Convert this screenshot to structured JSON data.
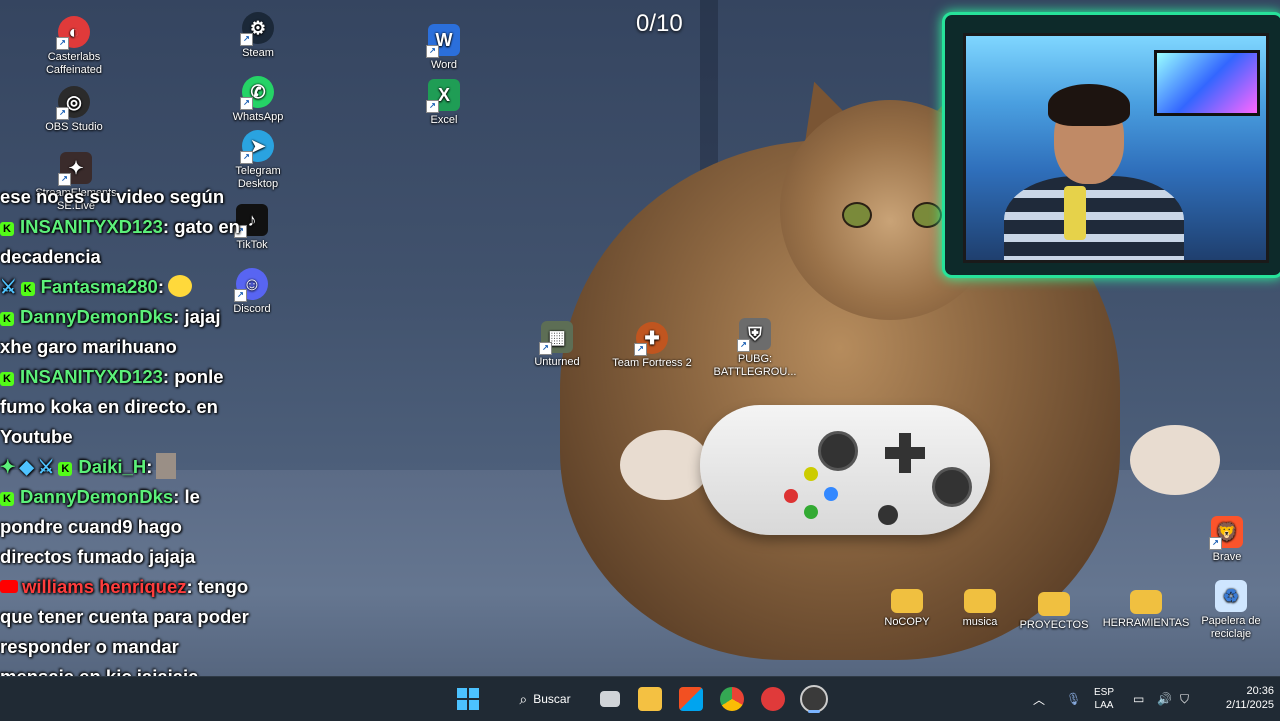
{
  "desktop": {
    "counter": "0/10",
    "icons": [
      {
        "label": "Casterlabs Caffeinated",
        "icon": "casterlabs-icon",
        "color": "#e03a3a"
      },
      {
        "label": "OBS Studio",
        "icon": "obs-icon",
        "color": "#2b2b2b"
      },
      {
        "label": "StreamElements SE.Live",
        "icon": "streamelements-icon",
        "color": "#3a2b2b"
      },
      {
        "label": "Steam",
        "icon": "steam-icon",
        "color": "#1b2838"
      },
      {
        "label": "WhatsApp",
        "icon": "whatsapp-icon",
        "color": "#25d366"
      },
      {
        "label": "Telegram Desktop",
        "icon": "telegram-icon",
        "color": "#2aa3e0"
      },
      {
        "label": "TikTok",
        "icon": "tiktok-icon",
        "color": "#111111"
      },
      {
        "label": "Discord",
        "icon": "discord-icon",
        "color": "#5865f2"
      },
      {
        "label": "Word",
        "icon": "word-icon",
        "color": "#2b6fdb"
      },
      {
        "label": "Excel",
        "icon": "excel-icon",
        "color": "#1f9d55"
      },
      {
        "label": "Unturned",
        "icon": "unturned-icon",
        "color": "#5d6e55"
      },
      {
        "label": "Team Fortress 2",
        "icon": "tf2-icon",
        "color": "#c0551f"
      },
      {
        "label": "PUBG: BATTLEGROU...",
        "icon": "pubg-icon",
        "color": "#6c6c6c"
      },
      {
        "label": "Brave",
        "icon": "brave-icon",
        "color": "#fb542b"
      },
      {
        "label": "NoCOPY",
        "icon": "folder-icon",
        "color": "#f0c040"
      },
      {
        "label": "musica",
        "icon": "folder-icon",
        "color": "#f0c040"
      },
      {
        "label": "PROYECTOS",
        "icon": "folder-icon",
        "color": "#f0c040"
      },
      {
        "label": "HERRAMIENTAS",
        "icon": "folder-icon",
        "color": "#f0c040"
      },
      {
        "label": "Papelera de reciclaje",
        "icon": "recycle-bin-icon",
        "color": "#cfe6ff"
      }
    ]
  },
  "chat": {
    "lines": [
      {
        "text": "ese no es su video según"
      },
      {
        "user": "INSANITYXD123",
        "text": ": gato en"
      },
      {
        "text": "decadencia"
      },
      {
        "user": "Fantasma280",
        "text": ":"
      },
      {
        "user": "DannyDemonDks",
        "text": ": jajaj"
      },
      {
        "text": "xhe garo marihuano"
      },
      {
        "user": "INSANITYXD123",
        "text": ": ponle"
      },
      {
        "text": "fumo koka en directo. en"
      },
      {
        "text": "Youtube"
      },
      {
        "user": "Daiki_H",
        "text": ":"
      },
      {
        "user": "DannyDemonDks",
        "text": ": le"
      },
      {
        "text": "pondre cuand9 hago"
      },
      {
        "text": "directos fumado jajaja"
      },
      {
        "user": "williams henriquez",
        "text": ": tengo"
      },
      {
        "text": "que tener cuenta para poder"
      },
      {
        "text": "responder o mandar"
      },
      {
        "text": "mensaje en kic jajajaja"
      }
    ]
  },
  "taskbar": {
    "search_label": "Buscar",
    "lang_top": "ESP",
    "lang_bottom": "LAA",
    "time": "20:36",
    "date": "2/11/2025",
    "apps": [
      "start-icon",
      "search-icon",
      "task-view-icon",
      "file-explorer-icon",
      "microsoft-store-icon",
      "chrome-icon",
      "casterlabs-icon",
      "obs-icon"
    ]
  },
  "colors": {
    "taskbar_bg": "#202a34",
    "chat_username": "#5cf07a",
    "kick_green": "#53fc18",
    "webcam_border": "#27e29a"
  }
}
